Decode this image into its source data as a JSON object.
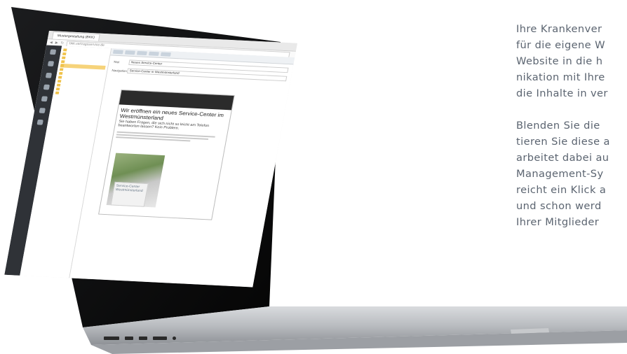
{
  "marketing_text": {
    "paragraph_1": [
      "Ihre Krankenver",
      "für die eigene W",
      "Website in die h",
      "nikation mit Ihre",
      "die Inhalte in ver"
    ],
    "paragraph_2": [
      "Blenden Sie die",
      "tieren Sie diese a",
      "arbeitet dabei au",
      "Management-Sy",
      "reicht ein Klick a",
      "und schon werd",
      "Ihrer Mitglieder"
    ]
  },
  "screen": {
    "browser_tab": "Mustergestaltung (BKK)",
    "address": "bkk.vertragsservice.de",
    "editor_headline": "Wir eröffnen ein neues Service-Center im Westmünsterland",
    "editor_subline": "Sie haben Fragen, die sich nicht so leicht am Telefon beantworten lassen? Kein Problem.",
    "form_title_label": "Titel",
    "form_title_value": "Neues Service-Center",
    "form_nav_label": "Navigation",
    "form_nav_value": "Service-Center in Westmünsterland",
    "sign_text": "Service-Center Westmünsterland",
    "colors": {
      "accent_folder": "#f0c24a",
      "rail_bg": "#2f3237",
      "body_text": "#5b6470"
    }
  }
}
